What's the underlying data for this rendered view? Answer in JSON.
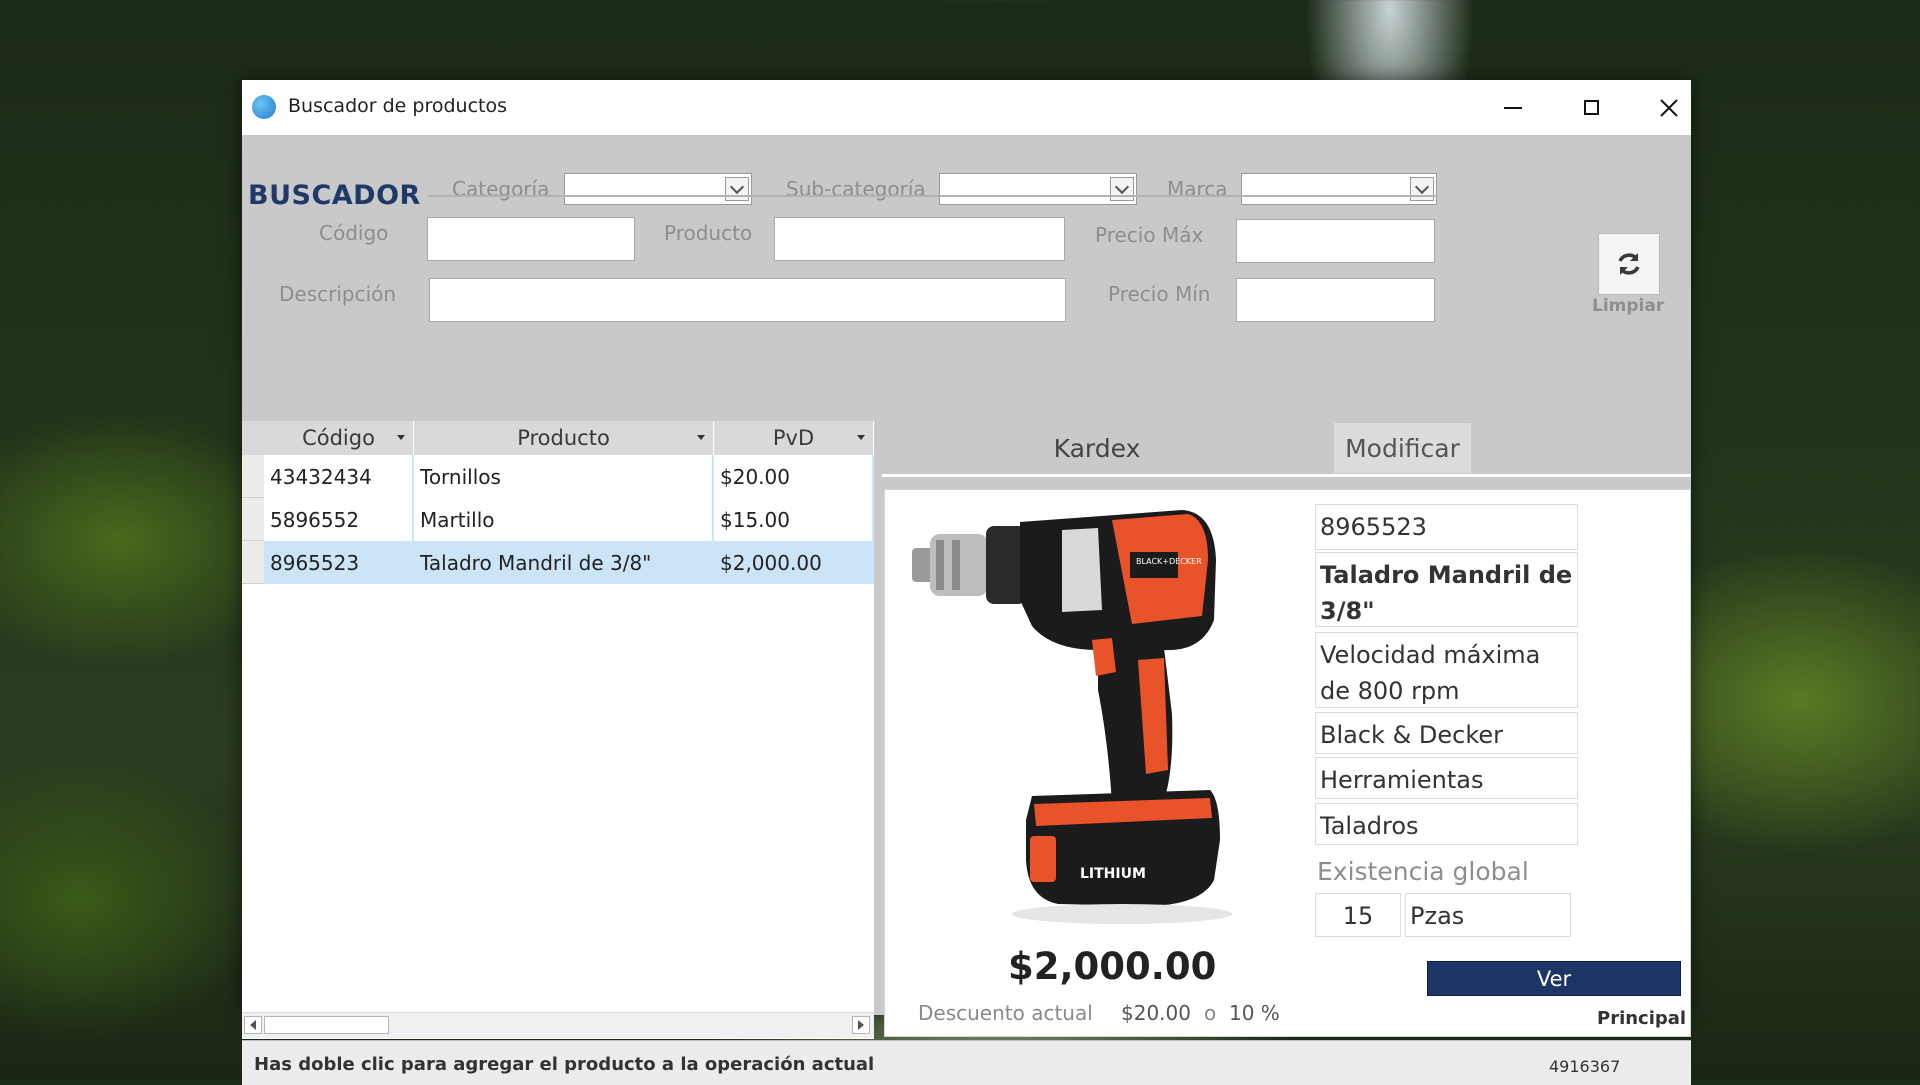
{
  "window": {
    "title": "Buscador de productos",
    "controls": {
      "minimize": "minimize-icon",
      "maximize": "maximize-icon",
      "close": "close-icon"
    }
  },
  "search": {
    "heading": "BUSCADOR",
    "categoria_label": "Categoría",
    "categoria_value": "",
    "subcategoria_label": "Sub-categoría",
    "subcategoria_value": "",
    "marca_label": "Marca",
    "marca_value": "",
    "codigo_label": "Código",
    "codigo_value": "",
    "producto_label": "Producto",
    "producto_value": "",
    "precio_max_label": "Precio Máx",
    "precio_max_value": "",
    "descripcion_label": "Descripción",
    "descripcion_value": "",
    "precio_min_label": "Precio Mín",
    "precio_min_value": "",
    "limpiar_label": "Limpiar",
    "refresh_icon": "refresh-icon"
  },
  "grid": {
    "columns": [
      "Código",
      "Producto",
      "PvD"
    ],
    "rows": [
      {
        "codigo": "43432434",
        "producto": "Tornillos",
        "pvd": "$20.00"
      },
      {
        "codigo": "5896552",
        "producto": "Martillo",
        "pvd": "$15.00"
      },
      {
        "codigo": "8965523",
        "producto": "Taladro Mandril de 3/8\"",
        "pvd": "$2,000.00",
        "selected": true
      }
    ]
  },
  "tabs": {
    "kardex": "Kardex",
    "modificar": "Modificar"
  },
  "detail": {
    "codigo": "8965523",
    "nombre": "Taladro Mandril de 3/8\"",
    "descripcion": "Velocidad máxima de 800 rpm",
    "marca": "Black & Decker",
    "categoria": "Herramientas",
    "subcategoria": "Taladros",
    "existencia_label": "Existencia global",
    "existencia_cantidad": "15",
    "existencia_unidad": "Pzas",
    "precio": "$2,000.00",
    "descuento_label": "Descuento actual",
    "descuento_monto": "$20.00",
    "descuento_o": "o",
    "descuento_pct": "10 %",
    "ver_label": "Ver",
    "principal_label": "Principal",
    "image_label_brand": "BLACK+DECKER",
    "image_label_lithium": "LITHIUM",
    "colors": {
      "accent": "#1d3566",
      "drill_orange": "#e8532a",
      "drill_black": "#1b1b1b"
    }
  },
  "status": {
    "hint": "Has doble clic para agregar el producto a la operación actual",
    "id": "4916367"
  }
}
